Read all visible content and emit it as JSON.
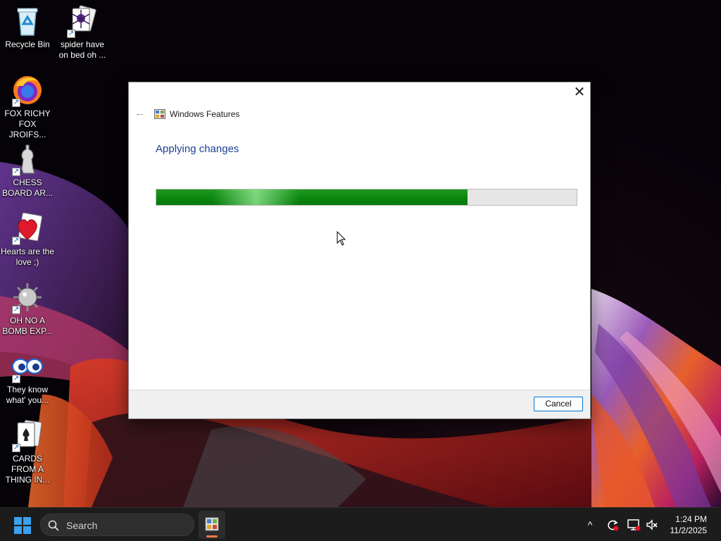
{
  "desktop": {
    "icons": [
      {
        "label": "Recycle Bin",
        "icon": "recycle-bin-icon"
      },
      {
        "label": "spider have on bed oh ...",
        "icon": "spider-card-icon"
      },
      {
        "label": "FOX RICHY FOX JROIFS...",
        "icon": "firefox-icon"
      },
      {
        "label": "CHESS BOARD AR...",
        "icon": "chess-icon"
      },
      {
        "label": "Hearts are the love ;)",
        "icon": "hearts-icon"
      },
      {
        "label": "OH NO A BOMB EXP...",
        "icon": "mine-icon"
      },
      {
        "label": "They know what' you...",
        "icon": "eyes-icon"
      },
      {
        "label": "CARDS FROM A THING IN...",
        "icon": "cards-icon"
      }
    ]
  },
  "dialog": {
    "title": "Windows Features",
    "heading": "Applying changes",
    "progress": 0.74,
    "cancel_label": "Cancel",
    "close_glyph": "✕",
    "back_glyph": "←"
  },
  "taskbar": {
    "search_placeholder": "Search",
    "clock_time": "1:24 PM",
    "clock_date": "11/2/2025",
    "tray_chevron": "^"
  },
  "colors": {
    "accent": "#0078d4",
    "progress_green": "#0f8a12",
    "heading_blue": "#1c3f94",
    "taskbar_bg": "#1c1c1c"
  }
}
